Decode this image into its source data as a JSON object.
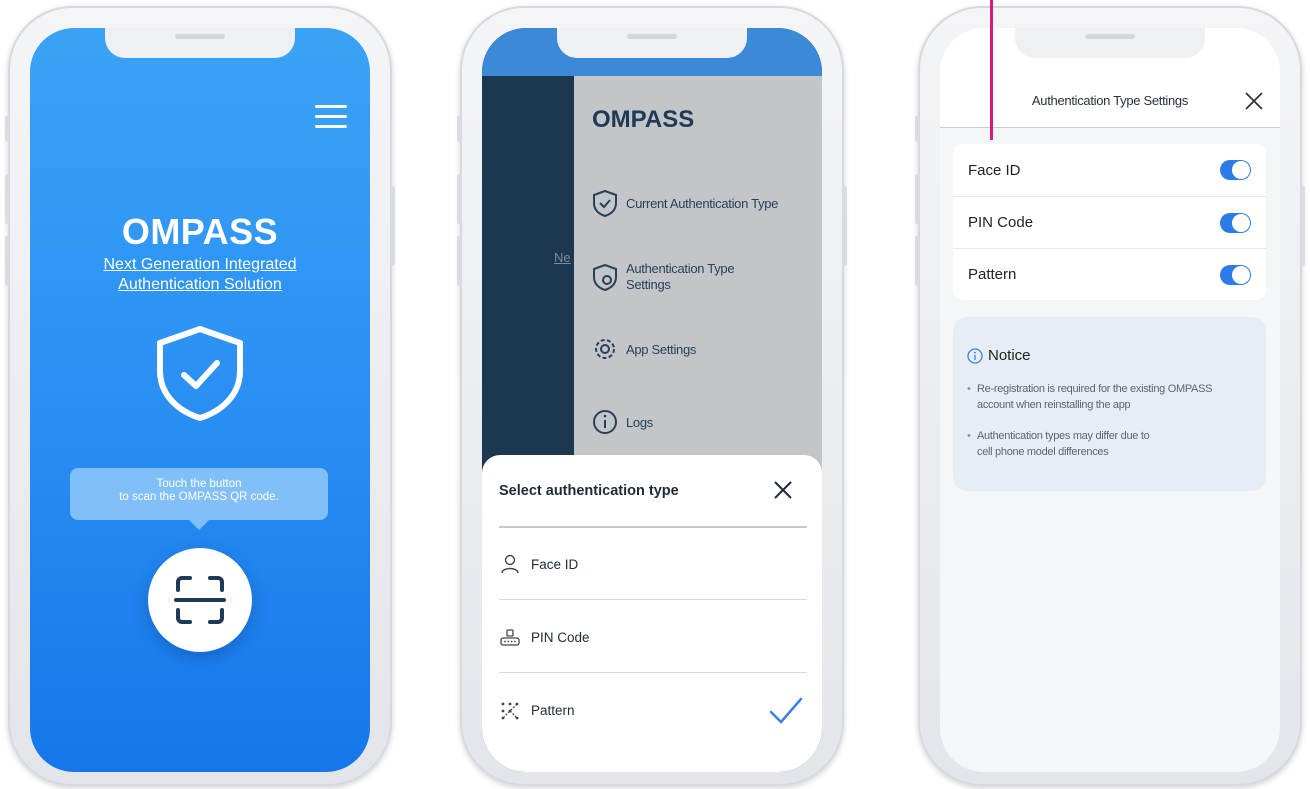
{
  "phone1": {
    "title": "OMPASS",
    "subtitle_line1": "Next Generation Integrated",
    "subtitle_line2": "Authentication Solution",
    "tooltip_line1": "Touch the button",
    "tooltip_line2": "to scan the OMPASS QR code.",
    "icons": [
      "menu-icon",
      "shield-check-icon",
      "qr-scan-icon"
    ]
  },
  "phone2": {
    "background_text": "Ne",
    "drawer": {
      "logo": "OMPASS",
      "items": [
        {
          "label": "Current Authentication Type",
          "icon": "shield-check-icon"
        },
        {
          "label_line1": "Authentication Type",
          "label_line2": "Settings",
          "icon": "shield-gear-icon"
        },
        {
          "label": "App Settings",
          "icon": "gear-icon"
        },
        {
          "label": "Logs",
          "icon": "info-icon"
        }
      ]
    },
    "sheet": {
      "title": "Select authentication type",
      "options": [
        {
          "label": "Face ID",
          "icon": "person-icon",
          "selected": false
        },
        {
          "label": "PIN Code",
          "icon": "keypad-icon",
          "selected": false
        },
        {
          "label": "Pattern",
          "icon": "pattern-icon",
          "selected": true
        }
      ]
    }
  },
  "phone3": {
    "header_title": "Authentication Type Settings",
    "settings": [
      {
        "label": "Face ID",
        "enabled": true
      },
      {
        "label": "PIN Code",
        "enabled": true
      },
      {
        "label": "Pattern",
        "enabled": true
      }
    ],
    "notice": {
      "title": "Notice",
      "items": [
        {
          "line1": "Re-registration is required for the existing OMPASS",
          "line2": "account when reinstalling the app"
        },
        {
          "line1": "Authentication types may differ due to",
          "line2": "cell phone model differences"
        }
      ]
    }
  },
  "colors": {
    "primary_blue": "#2a8ff3",
    "navy": "#1e3b56",
    "toggle_on": "#2b7ce9",
    "annotation_pink": "#d81b7a"
  }
}
